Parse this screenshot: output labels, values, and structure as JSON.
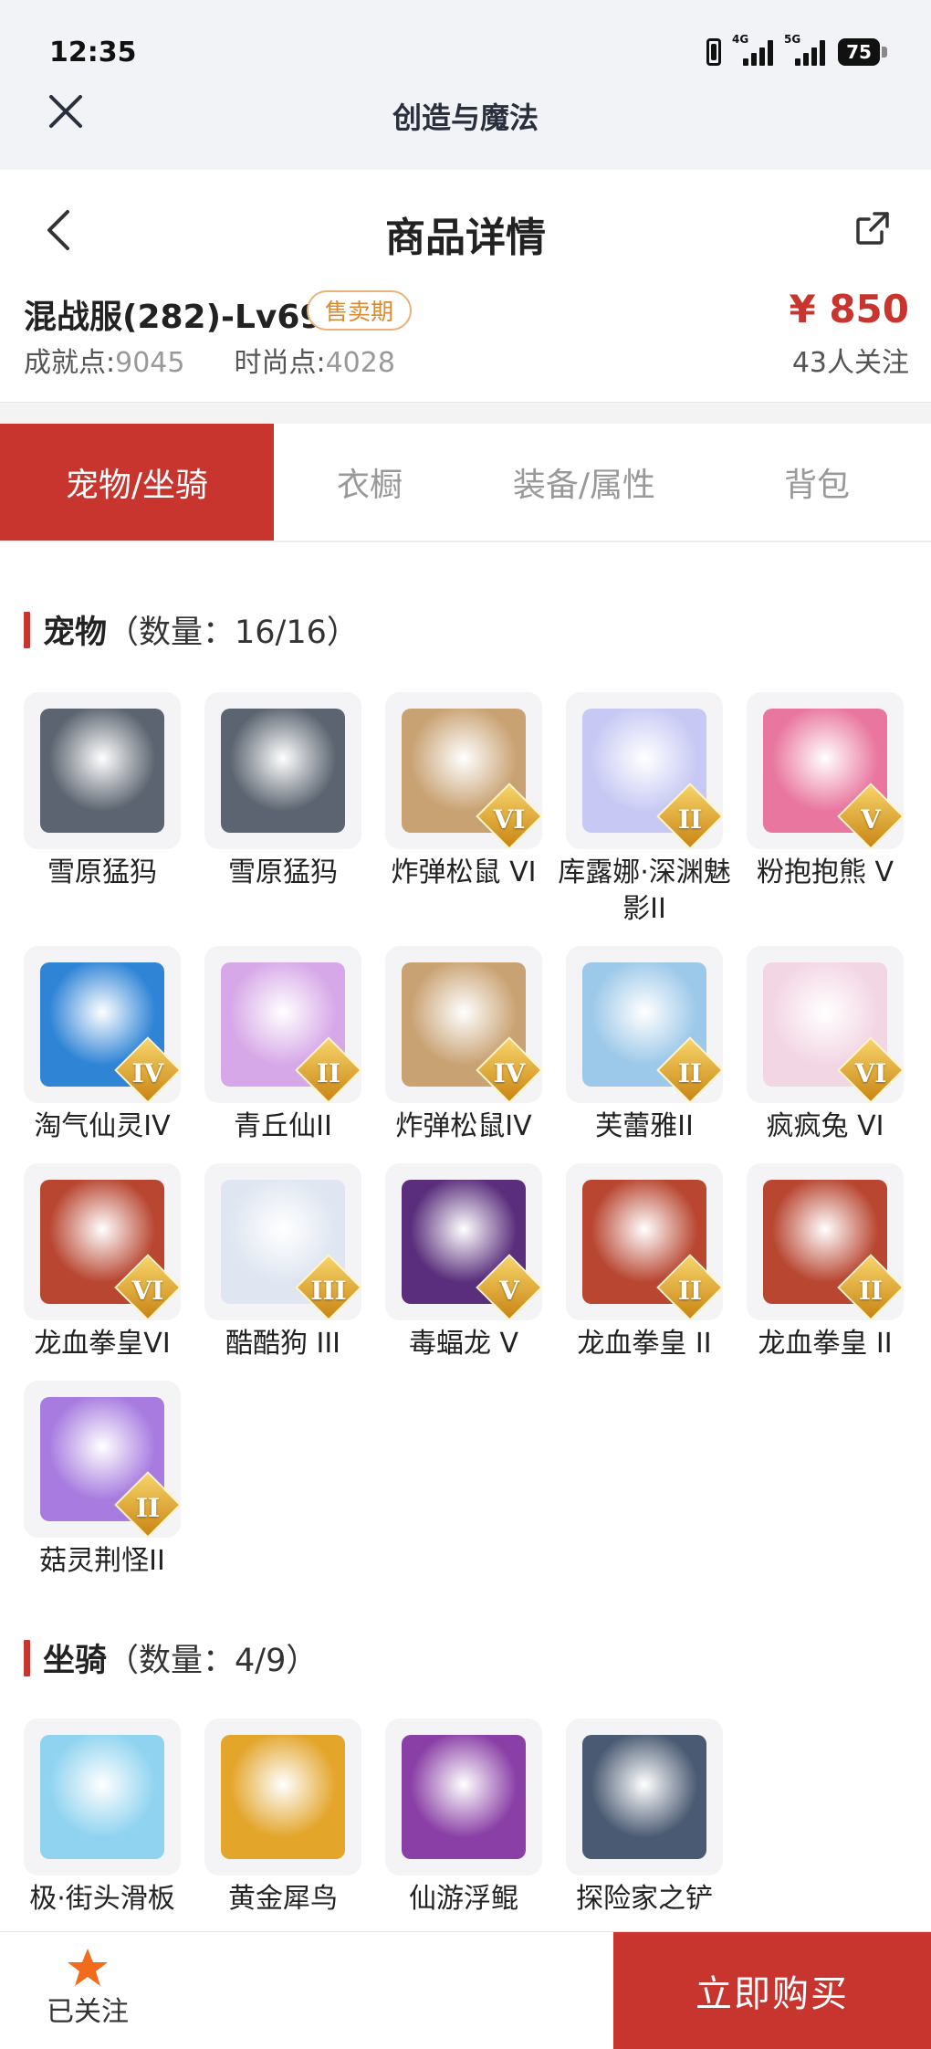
{
  "status_bar": {
    "time": "12:35",
    "net1": "4G",
    "net2": "5G",
    "battery": "75"
  },
  "app_bar": {
    "title": "创造与魔法"
  },
  "header": {
    "title": "商品详情"
  },
  "product": {
    "name": "混战服(282)-Lv69",
    "badge": "售卖期",
    "achievement_label": "成就点:",
    "achievement_value": "9045",
    "fashion_label": "时尚点:",
    "fashion_value": "4028",
    "price": "¥ 850",
    "followers": "43人关注"
  },
  "tabs": [
    {
      "label": "宠物/坐骑",
      "active": true
    },
    {
      "label": "衣橱",
      "active": false
    },
    {
      "label": "装备/属性",
      "active": false
    },
    {
      "label": "背包",
      "active": false
    }
  ],
  "pets": {
    "title": "宠物",
    "count": "（数量：16/16）",
    "items": [
      {
        "name": "雪原猛犸",
        "rank": "",
        "icon": "mammoth",
        "color": "#5b6470"
      },
      {
        "name": "雪原猛犸",
        "rank": "",
        "icon": "mammoth",
        "color": "#5b6470"
      },
      {
        "name": "炸弹松鼠 VI",
        "rank": "VI",
        "icon": "squirrel",
        "color": "#c9a273"
      },
      {
        "name": "库露娜·深渊魅影II",
        "rank": "II",
        "icon": "fairy",
        "color": "#c7c9f4"
      },
      {
        "name": "粉抱抱熊 V",
        "rank": "V",
        "icon": "bear",
        "color": "#e9769e"
      },
      {
        "name": "淘气仙灵IV",
        "rank": "IV",
        "icon": "dog",
        "color": "#2f84d6"
      },
      {
        "name": "青丘仙II",
        "rank": "II",
        "icon": "fox-girl",
        "color": "#d7a8e8"
      },
      {
        "name": "炸弹松鼠IV",
        "rank": "IV",
        "icon": "squirrel",
        "color": "#c9a273"
      },
      {
        "name": "芙蕾雅II",
        "rank": "II",
        "icon": "valkyrie",
        "color": "#9cc8e9"
      },
      {
        "name": "疯疯兔 VI",
        "rank": "VI",
        "icon": "rabbit",
        "color": "#f3d6e4"
      },
      {
        "name": "龙血拳皇VI",
        "rank": "VI",
        "icon": "ram",
        "color": "#b84631"
      },
      {
        "name": "酷酷狗 III",
        "rank": "III",
        "icon": "polar-bear",
        "color": "#dfe6f1"
      },
      {
        "name": "毒蝠龙 V",
        "rank": "V",
        "icon": "bat-dragon",
        "color": "#5a2e7c"
      },
      {
        "name": "龙血拳皇 II",
        "rank": "II",
        "icon": "ram",
        "color": "#b84631"
      },
      {
        "name": "龙血拳皇 II",
        "rank": "II",
        "icon": "ram",
        "color": "#b84631"
      },
      {
        "name": "菇灵荆怪II",
        "rank": "II",
        "icon": "mushroom",
        "color": "#a77be0"
      }
    ]
  },
  "mounts": {
    "title": "坐骑",
    "count": "（数量：4/9）",
    "items": [
      {
        "name": "极·街头滑板",
        "rank": "",
        "icon": "skateboard",
        "color": "#8fd3f0"
      },
      {
        "name": "黄金犀鸟",
        "rank": "",
        "icon": "hornbill",
        "color": "#e3a52a"
      },
      {
        "name": "仙游浮鲲",
        "rank": "",
        "icon": "whale",
        "color": "#8a3fa6"
      },
      {
        "name": "探险家之铲",
        "rank": "",
        "icon": "shovel",
        "color": "#4a5a72"
      }
    ]
  },
  "bottom_bar": {
    "follow_label": "已关注",
    "buy_label": "立即购买"
  },
  "colors": {
    "accent": "#c8342e",
    "badge": "#d9892f",
    "star": "#f26a1b"
  }
}
